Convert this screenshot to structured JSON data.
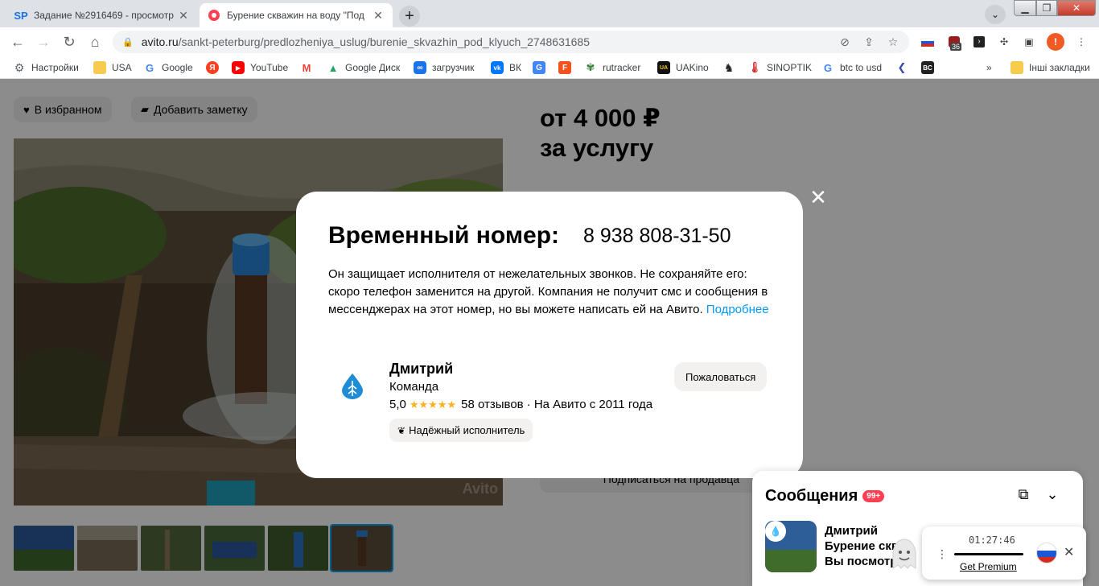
{
  "browser": {
    "tabs": [
      {
        "favicon": "SP",
        "title": "Задание №2916469 - просмотр"
      },
      {
        "favicon": "avito-dot",
        "title": "Бурение скважин на воду \"Под"
      }
    ],
    "new_tab": "+",
    "address": {
      "host": "avito.ru",
      "path": "/sankt-peterburg/predlozheniya_uslug/burenie_skvazhin_pod_klyuch_2748631685"
    },
    "extension_badge": "36",
    "profile_initial": "!",
    "bookmarks": [
      {
        "icon": "gear-icon",
        "label": "Настройки"
      },
      {
        "icon": "folder-icon",
        "label": "USA"
      },
      {
        "icon": "google-icon",
        "label": "Google"
      },
      {
        "icon": "yandex-icon",
        "label": ""
      },
      {
        "icon": "youtube-icon",
        "label": "YouTube"
      },
      {
        "icon": "gmail-icon",
        "label": ""
      },
      {
        "icon": "drive-icon",
        "label": "Google Диск"
      },
      {
        "icon": "loader-icon",
        "label": "загрузчик"
      },
      {
        "icon": "vk-icon",
        "label": "ВК"
      },
      {
        "icon": "translate-icon",
        "label": ""
      },
      {
        "icon": "f-icon",
        "label": ""
      },
      {
        "icon": "rutracker-icon",
        "label": "rutracker"
      },
      {
        "icon": "uakino-icon",
        "label": "UAKino"
      },
      {
        "icon": "chess-icon",
        "label": ""
      },
      {
        "icon": "thermometer-icon",
        "label": "SINOPTIK"
      },
      {
        "icon": "google-icon",
        "label": "btc to usd"
      },
      {
        "icon": "bolt-icon",
        "label": ""
      },
      {
        "icon": "bc-icon",
        "label": ""
      }
    ],
    "bookmarks_more": "»",
    "other_bookmarks": "Інші закладки"
  },
  "page": {
    "favorite_button": "В избранном",
    "note_button": "Добавить заметку",
    "price_line1": "от 4 000 ₽",
    "price_line2": "за услугу",
    "subscribe_button": "Подписаться на продавца",
    "watermark": "Avito"
  },
  "modal": {
    "title": "Временный номер:",
    "phone": "8 938 808-31-50",
    "text": "Он защищает исполнителя от нежелательных звонков. Не сохраняйте его: скоро телефон заменится на другой. Компания не получит смс и сообщения в мессенджерах на этот номер, но вы можете написать ей на Авито.",
    "link": "Подробнее",
    "seller": {
      "name": "Дмитрий",
      "role": "Команда",
      "rating": "5,0",
      "stars": "★★★★★",
      "reviews": "58 отзывов",
      "since": "· На Авито с 2011 года",
      "reliable": "Надёжный исполнитель"
    },
    "complain_button": "Пожаловаться"
  },
  "messages": {
    "title": "Сообщения",
    "badge": "99+",
    "item_name": "Дмитрий",
    "item_line2": "Бурение скв",
    "item_line3": "Вы посмотр"
  },
  "vpn": {
    "time": "01:27:46",
    "premium_link": "Get Premium"
  }
}
